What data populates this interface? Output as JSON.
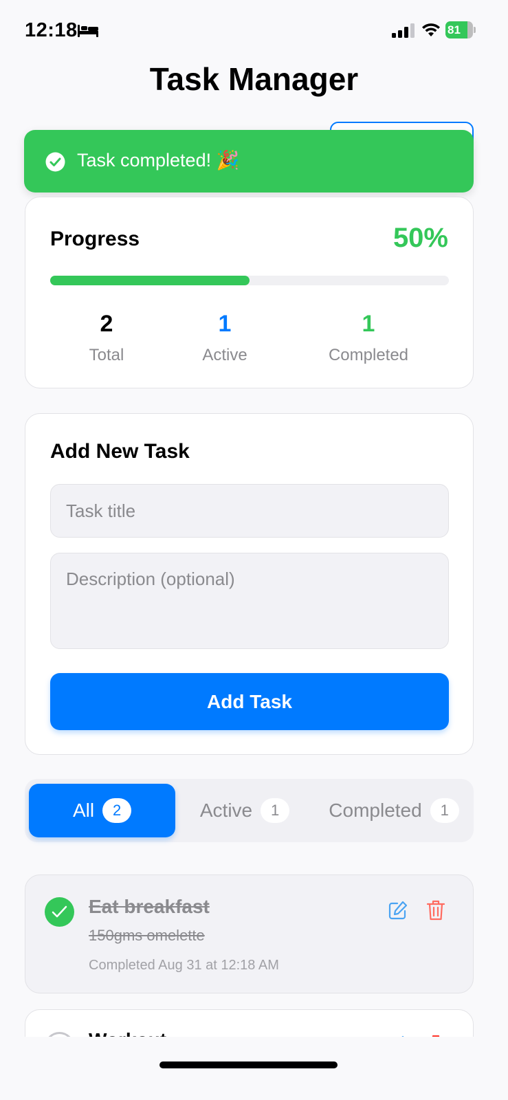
{
  "status_bar": {
    "time": "12:18",
    "battery_level": "81",
    "battery_fraction": 0.81,
    "icons": [
      "bed-icon",
      "cellular-signal-icon",
      "wifi-icon",
      "battery-charging-icon"
    ]
  },
  "header": {
    "title": "Task Manager"
  },
  "toast": {
    "message": "Task completed! 🎉",
    "icon": "check-circle-icon",
    "color": "#34c759"
  },
  "progress": {
    "label": "Progress",
    "percent_text": "50%",
    "percent_value": 0.5,
    "stats": [
      {
        "value": "2",
        "label": "Total"
      },
      {
        "value": "1",
        "label": "Active"
      },
      {
        "value": "1",
        "label": "Completed"
      }
    ]
  },
  "add_task": {
    "title": "Add New Task",
    "title_placeholder": "Task title",
    "description_placeholder": "Description (optional)",
    "button_label": "Add Task"
  },
  "filters": [
    {
      "label": "All",
      "count": "2",
      "selected": true
    },
    {
      "label": "Active",
      "count": "1",
      "selected": false
    },
    {
      "label": "Completed",
      "count": "1",
      "selected": false
    }
  ],
  "tasks": [
    {
      "title": "Eat breakfast",
      "description": "150gms omelette",
      "meta": "Completed Aug 31 at 12:18 AM",
      "completed": true
    },
    {
      "title": "Workout",
      "completed": false
    }
  ],
  "colors": {
    "accent": "#007aff",
    "success": "#34c759",
    "danger": "#ff3b30",
    "muted": "#8a8a8e"
  }
}
